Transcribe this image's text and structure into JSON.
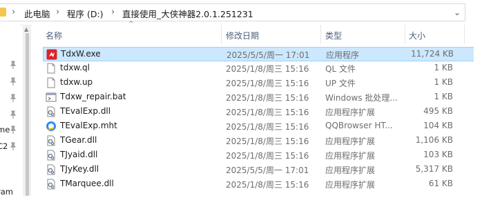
{
  "address": {
    "crumbs": [
      "此电脑",
      "程序 (D:)",
      "直接使用_大侠神器2.0.1.251231"
    ],
    "separator": "›",
    "dropdown_glyph": "⌄"
  },
  "nav": {
    "items": [
      {
        "label": "",
        "pinned": true
      },
      {
        "label": "",
        "pinned": true
      },
      {
        "label": "",
        "pinned": true
      },
      {
        "label": "",
        "pinned": true
      },
      {
        "label": "me",
        "pinned": true
      },
      {
        "label": "C2",
        "pinned": true
      },
      {
        "label": "",
        "pinned": false
      },
      {
        "label": "ram",
        "pinned": false
      }
    ]
  },
  "columns": {
    "name": "名称",
    "modified": "修改日期",
    "type": "类型",
    "size": "大小"
  },
  "files": [
    {
      "name": "TdxW.exe",
      "modified": "2025/5/5/周一 17:01",
      "type": "应用程序",
      "size": "11,724 KB",
      "icon": "exe-red-icon",
      "selected": true
    },
    {
      "name": "tdxw.ql",
      "modified": "2025/1/8/周三 15:16",
      "type": "QL 文件",
      "size": "1 KB",
      "icon": "file-icon",
      "selected": false
    },
    {
      "name": "tdxw.up",
      "modified": "2025/1/8/周三 15:16",
      "type": "UP 文件",
      "size": "1 KB",
      "icon": "file-icon",
      "selected": false
    },
    {
      "name": "Tdxw_repair.bat",
      "modified": "2025/1/8/周三 15:16",
      "type": "Windows 批处理...",
      "size": "1 KB",
      "icon": "bat-icon",
      "selected": false
    },
    {
      "name": "TEvalExp.dll",
      "modified": "2025/1/8/周三 15:16",
      "type": "应用程序扩展",
      "size": "495 KB",
      "icon": "dll-icon",
      "selected": false
    },
    {
      "name": "TEvalExp.mht",
      "modified": "2025/1/8/周三 15:16",
      "type": "QQBrowser HT...",
      "size": "104 KB",
      "icon": "browser-icon",
      "selected": false
    },
    {
      "name": "TGear.dll",
      "modified": "2025/1/8/周三 15:16",
      "type": "应用程序扩展",
      "size": "1,106 KB",
      "icon": "dll-icon",
      "selected": false
    },
    {
      "name": "TJyaid.dll",
      "modified": "2025/1/8/周三 15:16",
      "type": "应用程序扩展",
      "size": "103 KB",
      "icon": "dll-icon",
      "selected": false
    },
    {
      "name": "TJyKey.dll",
      "modified": "2025/5/5/周一 17:01",
      "type": "应用程序扩展",
      "size": "5,317 KB",
      "icon": "dll-icon",
      "selected": false
    },
    {
      "name": "TMarquee.dll",
      "modified": "2025/1/8/周三 15:16",
      "type": "应用程序扩展",
      "size": "61 KB",
      "icon": "dll-icon",
      "selected": false
    }
  ],
  "colors": {
    "selection_bg": "#cce8ff",
    "selection_border": "#99d1ff",
    "header_text": "#4c607a",
    "folder_yellow": "#f3c74e"
  }
}
